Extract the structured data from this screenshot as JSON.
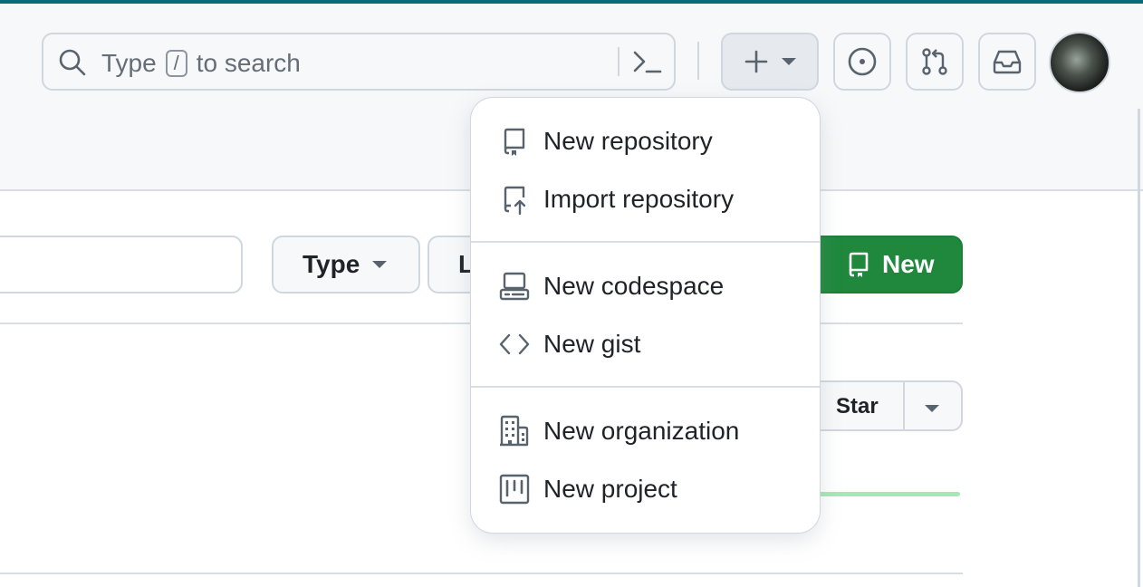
{
  "header": {
    "search": {
      "placeholder_before": "Type",
      "shortcut_key": "/",
      "placeholder_after": "to search",
      "icon": "search-icon",
      "command_icon": "command-palette-icon"
    },
    "buttons": [
      {
        "name": "create-new",
        "icon": "plus-icon"
      },
      {
        "name": "issues",
        "icon": "issue-opened-icon"
      },
      {
        "name": "pull-requests",
        "icon": "git-pull-request-icon"
      },
      {
        "name": "inbox",
        "icon": "inbox-icon"
      }
    ]
  },
  "toolbar": {
    "type_label": "Type",
    "language_label_partial": "L",
    "new_label": "New"
  },
  "repo_card": {
    "star_label": "Star"
  },
  "menu": {
    "items": [
      {
        "label": "New repository",
        "icon": "repo-icon"
      },
      {
        "label": "Import repository",
        "icon": "repo-push-icon"
      },
      {
        "label": "New codespace",
        "icon": "codespaces-icon"
      },
      {
        "label": "New gist",
        "icon": "code-icon"
      },
      {
        "label": "New organization",
        "icon": "organization-icon"
      },
      {
        "label": "New project",
        "icon": "project-icon"
      }
    ]
  },
  "colors": {
    "accent_top": "#0b6a7a",
    "primary_green": "#1f883d",
    "text": "#1f2328",
    "muted": "#656d76"
  }
}
